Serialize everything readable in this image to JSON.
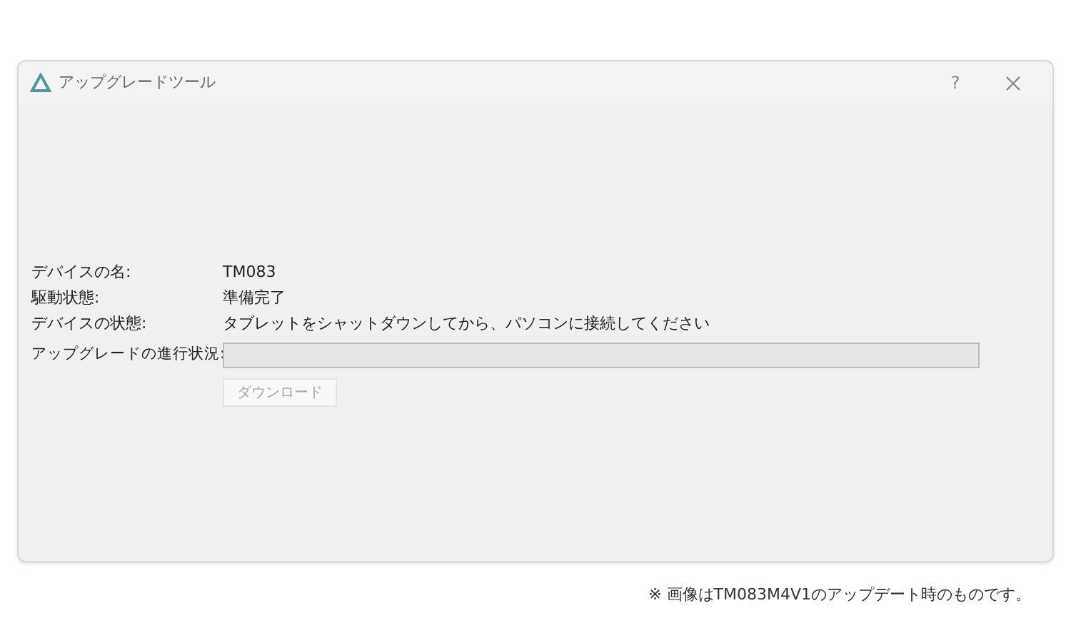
{
  "window": {
    "title": "アップグレードツール",
    "help": "?"
  },
  "fields": [
    {
      "label": "デバイスの名:",
      "value": "TM083"
    },
    {
      "label": "駆動状態:",
      "value": "準備完了"
    },
    {
      "label": "デバイスの状態:",
      "value": "タブレットをシャットダウンしてから、パソコンに接続してください"
    }
  ],
  "progress": {
    "label": "アップグレードの進行状況:",
    "level": 0
  },
  "download_button": {
    "label": "ダウンロード",
    "disabled": true
  },
  "caption": "※ 画像はTM083M4V1のアップデート時のものです。"
}
